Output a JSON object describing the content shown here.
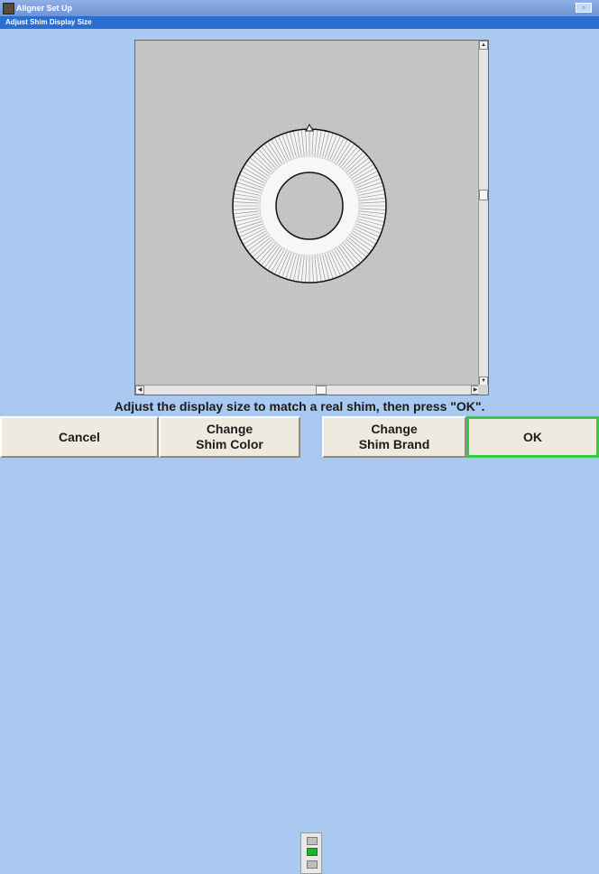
{
  "window": {
    "title": "Aligner Set Up",
    "subtitle": "Adjust Shim Display Size"
  },
  "instruction": "Adjust the display size to match a real shim, then press \"OK\".",
  "buttons": {
    "cancel": "Cancel",
    "change_color": "Change\nShim Color",
    "change_brand": "Change\nShim Brand",
    "ok": "OK"
  },
  "colors": {
    "ok_border": "#32cc3c",
    "indicator_active": "#24b02c"
  },
  "icons": {
    "scroll_up": "▲",
    "scroll_down": "▼",
    "scroll_left": "◀",
    "scroll_right": "▶"
  }
}
